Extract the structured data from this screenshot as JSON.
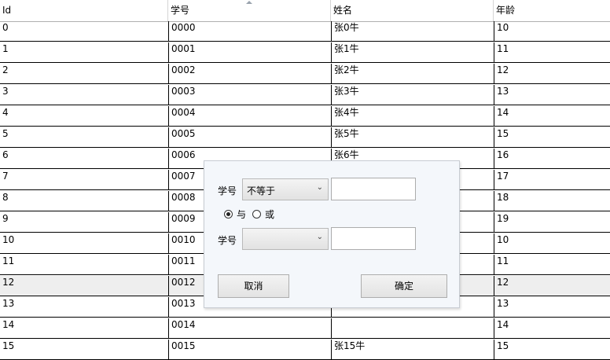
{
  "grid": {
    "columns": [
      "Id",
      "学号",
      "姓名",
      "年龄"
    ],
    "selected_row_index": 12,
    "rows": [
      [
        "0",
        "0000",
        "张0牛",
        "10"
      ],
      [
        "1",
        "0001",
        "张1牛",
        "11"
      ],
      [
        "2",
        "0002",
        "张2牛",
        "12"
      ],
      [
        "3",
        "0003",
        "张3牛",
        "13"
      ],
      [
        "4",
        "0004",
        "张4牛",
        "14"
      ],
      [
        "5",
        "0005",
        "张5牛",
        "15"
      ],
      [
        "6",
        "0006",
        "张6牛",
        "16"
      ],
      [
        "7",
        "0007",
        "",
        "17"
      ],
      [
        "8",
        "0008",
        "",
        "18"
      ],
      [
        "9",
        "0009",
        "",
        "19"
      ],
      [
        "10",
        "0010",
        "",
        "10"
      ],
      [
        "11",
        "0011",
        "",
        "11"
      ],
      [
        "12",
        "0012",
        "",
        "12"
      ],
      [
        "13",
        "0013",
        "",
        "13"
      ],
      [
        "14",
        "0014",
        "",
        "14"
      ],
      [
        "15",
        "0015",
        "张15牛",
        "15"
      ]
    ]
  },
  "filter_popup": {
    "condition1": {
      "field_label": "学号",
      "operator": "不等于",
      "value": ""
    },
    "logic": {
      "and_label": "与",
      "or_label": "或",
      "selected": "and"
    },
    "condition2": {
      "field_label": "学号",
      "operator": "",
      "value": ""
    },
    "cancel_label": "取消",
    "ok_label": "确定"
  }
}
